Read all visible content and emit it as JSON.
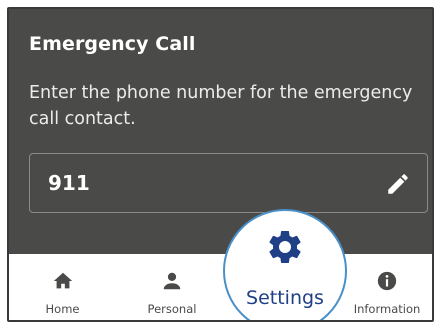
{
  "panel": {
    "title": "Emergency Call",
    "description": "Enter the phone number for the emergency call contact.",
    "phone_number": "911"
  },
  "nav": {
    "items": [
      {
        "label": "Home",
        "icon": "home-icon"
      },
      {
        "label": "Personal",
        "icon": "person-icon"
      },
      {
        "label": "Settings",
        "icon": "gear-icon",
        "active": true
      },
      {
        "label": "Information",
        "icon": "info-icon"
      }
    ]
  },
  "colors": {
    "panel_bg": "#4a4a48",
    "active_accent": "#1f3f86",
    "active_ring": "#4a90c8",
    "nav_text": "#4a4a48"
  }
}
